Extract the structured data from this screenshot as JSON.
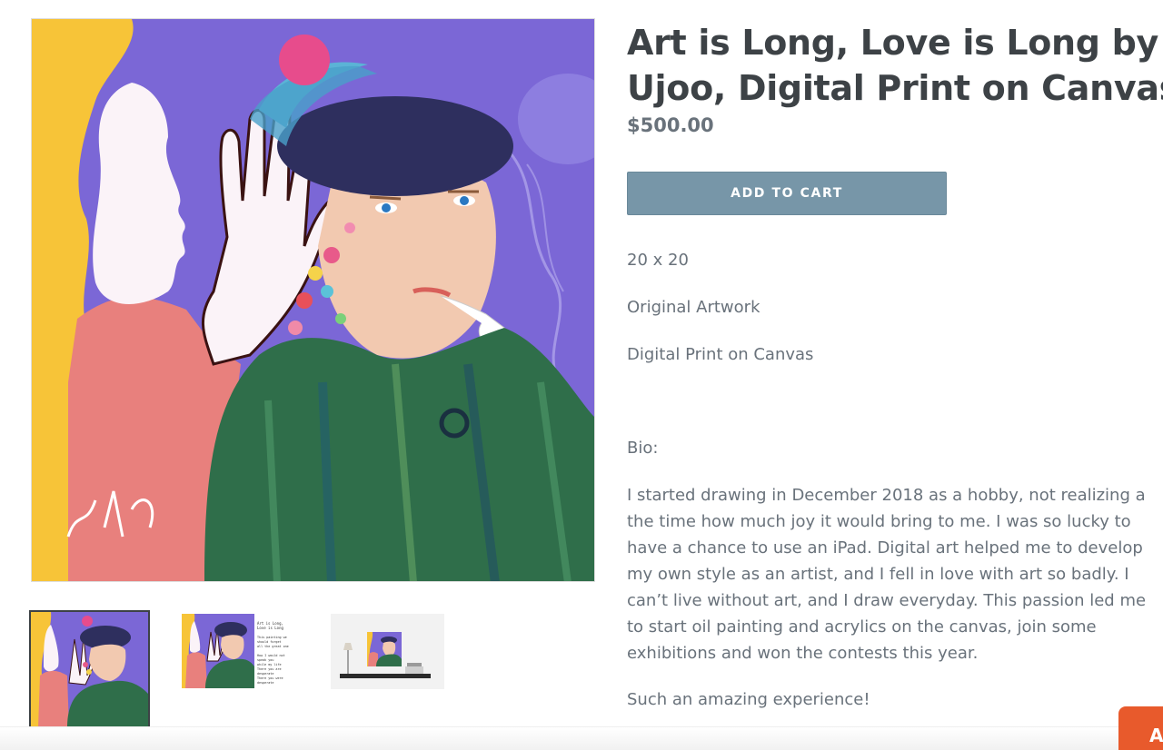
{
  "product": {
    "title_line1": "Art is Long, Love is Long by",
    "title_line2": "Ujoo, Digital Print on Canvas",
    "price": "$500.00",
    "add_to_cart_label": "Add to cart",
    "description": {
      "size": "20 x 20",
      "type": "Original Artwork",
      "medium": "Digital Print on Canvas",
      "bio_heading": "Bio:",
      "bio_lines": [
        "I started drawing in December 2018 as a hobby, not realizing a",
        "the time how much joy it would bring to me. I was so lucky to",
        "have a chance to use an iPad. Digital art helped me to develop",
        "my own style as an artist, and I fell in love with art so badly. I",
        "can’t live without art, and I draw everyday. This passion led me",
        "to start oil painting and acrylics on the canvas, join some",
        "exhibitions and won the contests this year."
      ],
      "closing": "Such an amazing experience!"
    }
  },
  "thumbnails": [
    {
      "name": "painting",
      "active": true
    },
    {
      "name": "painting-with-text",
      "active": false
    },
    {
      "name": "room-mockup",
      "active": false
    }
  ],
  "thumb2_text": {
    "heading": "Art is Long, Love is Long",
    "lines": [
      "This painting we should forget",
      "all the great one",
      "",
      "How I would not speak you",
      "while my life",
      "There you are desperate",
      "There you were desperate"
    ]
  },
  "floating_button_label": "A",
  "colors": {
    "accent_button": "#7796a8",
    "title": "#3d4246",
    "price": "#69727b",
    "body_text": "#69727b",
    "float_button": "#e85a2c",
    "painting_bg": "#7b67d6"
  }
}
